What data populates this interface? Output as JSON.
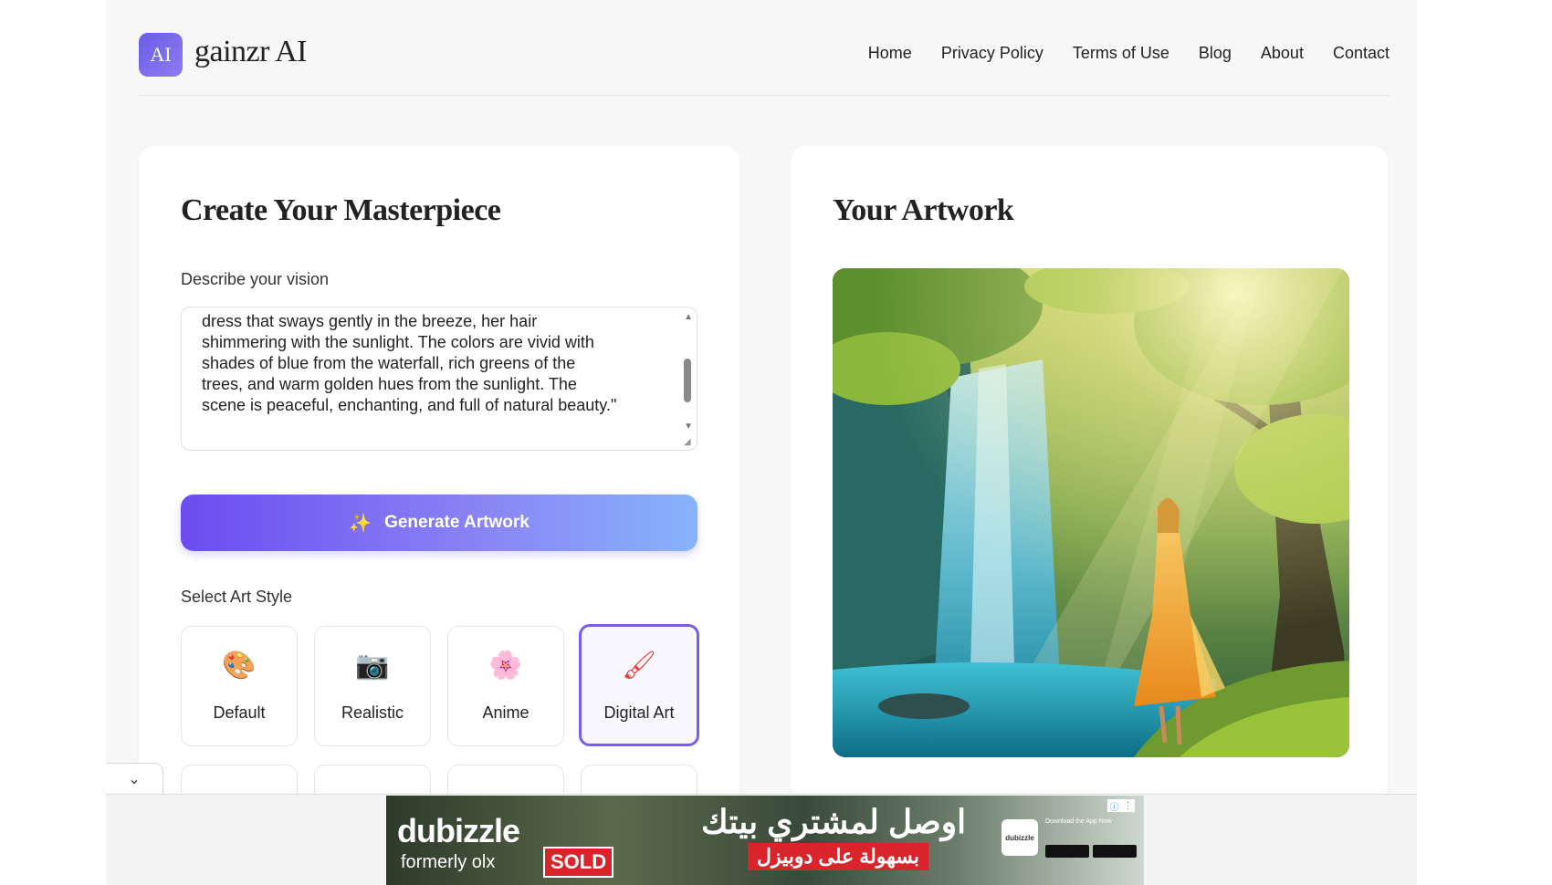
{
  "header": {
    "logo_badge": "AI",
    "logo_text": "gainzr AI",
    "nav": [
      "Home",
      "Privacy Policy",
      "Terms of Use",
      "Blog",
      "About",
      "Contact"
    ]
  },
  "create_card": {
    "title": "Create Your Masterpiece",
    "prompt_label": "Describe your vision",
    "prompt_value": "dress that sways gently in the breeze, her hair\nshimmering with the sunlight. The colors are vivid with\nshades of blue from the waterfall, rich greens of the\ntrees, and warm golden hues from the sunlight. The\nscene is peaceful, enchanting, and full of natural beauty.\"",
    "generate_button": "Generate Artwork",
    "style_label": "Select Art Style",
    "styles": [
      {
        "label": "Default",
        "icon": "palette-icon",
        "glyph": "🎨",
        "selected": false
      },
      {
        "label": "Realistic",
        "icon": "camera-icon",
        "glyph": "📷",
        "selected": false
      },
      {
        "label": "Anime",
        "icon": "flower-icon",
        "glyph": "🌸",
        "selected": false
      },
      {
        "label": "Digital Art",
        "icon": "paintbrush-icon",
        "glyph": "🖌",
        "selected": true
      }
    ]
  },
  "artwork_card": {
    "title": "Your Artwork"
  },
  "ad": {
    "brand": "dubizzle",
    "sub": "formerly olx",
    "sold": "SOLD",
    "headline_ar": "اوصل لمشتري بيتك",
    "sub_ar": "بسهولة على دوبيزل",
    "app_badge": "dubizzle",
    "small_text": "Download the App Now"
  },
  "colors": {
    "accent": "#6b4cf0",
    "gradient_end": "#86b4fb",
    "selected_border": "#7b5cf0"
  }
}
